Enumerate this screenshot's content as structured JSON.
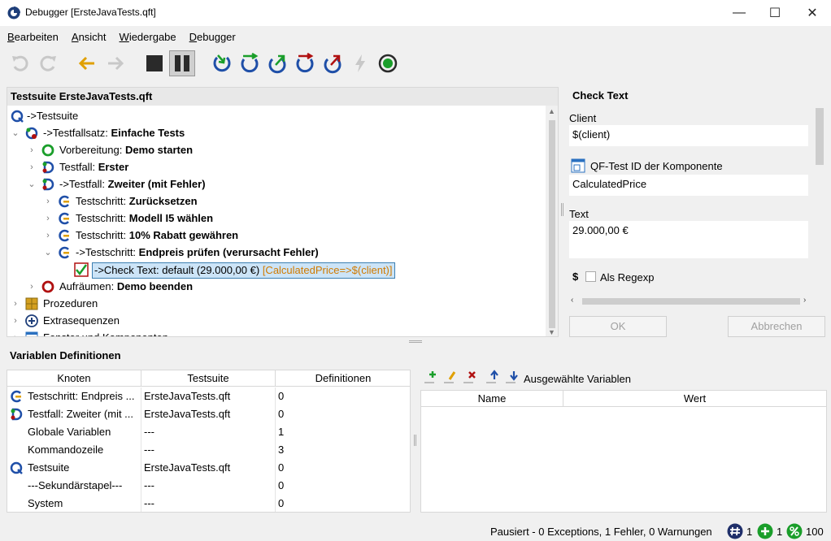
{
  "window": {
    "title": "Debugger [ErsteJavaTests.qft]",
    "minimize": "—",
    "maximize": "☐",
    "close": "✕"
  },
  "menu": [
    {
      "label": "Bearbeiten",
      "accel": "B",
      "rest": "earbeiten"
    },
    {
      "label": "Ansicht",
      "accel": "A",
      "rest": "nsicht"
    },
    {
      "label": "Wiedergabe",
      "accel": "W",
      "rest": "iedergabe"
    },
    {
      "label": "Debugger",
      "accel": "D",
      "rest": "ebugger"
    }
  ],
  "toolbar": {
    "icons": [
      "undo-icon",
      "redo-icon",
      "back-icon",
      "forward-icon",
      "stop-icon",
      "pause-icon",
      "step-in-icon",
      "step-over-icon",
      "step-out-icon",
      "skip-over-icon",
      "skip-out-icon",
      "continue-without-icon",
      "breakpoint-icon"
    ]
  },
  "tree": {
    "header": "Testsuite ErsteJavaTests.qft",
    "rows": [
      {
        "prefix": "->Testsuite",
        "bold": ""
      },
      {
        "prefix": "->Testfallsatz: ",
        "bold": "Einfache Tests"
      },
      {
        "prefix": "Vorbereitung: ",
        "bold": "Demo starten"
      },
      {
        "prefix": "Testfall: ",
        "bold": "Erster"
      },
      {
        "prefix": "->Testfall: ",
        "bold": "Zweiter (mit Fehler)"
      },
      {
        "prefix": "Testschritt: ",
        "bold": "Zurücksetzen"
      },
      {
        "prefix": "Testschritt: ",
        "bold": "Modell I5 wählen"
      },
      {
        "prefix": "Testschritt: ",
        "bold": "10% Rabatt gewähren"
      },
      {
        "prefix": "->Testschritt: ",
        "bold": "Endpreis prüfen (verursacht Fehler)"
      },
      {
        "prefix": "->Check Text: default (29.000,00 €) ",
        "extra": "[CalculatedPrice=>$(client)]"
      },
      {
        "prefix": "Aufräumen: ",
        "bold": "Demo beenden"
      },
      {
        "prefix": "Prozeduren",
        "bold": ""
      },
      {
        "prefix": "Extrasequenzen",
        "bold": ""
      },
      {
        "prefix": "Fenster und Komponenten",
        "bold": ""
      }
    ]
  },
  "check": {
    "title": "Check Text",
    "client_label": "Client",
    "client_value": "$(client)",
    "component_label": "QF-Test ID der Komponente",
    "component_value": "CalculatedPrice",
    "text_label": "Text",
    "text_value": "29.000,00 €",
    "regexp_label": "Als Regexp",
    "regexp_symbol": "$",
    "ok": "OK",
    "cancel": "Abbrechen"
  },
  "vars": {
    "title": "Variablen Definitionen",
    "columns": [
      "Knoten",
      "Testsuite",
      "Definitionen"
    ],
    "rows": [
      [
        "Testschritt: Endpreis ...",
        "ErsteJavaTests.qft",
        "0"
      ],
      [
        "Testfall: Zweiter (mit ...",
        "ErsteJavaTests.qft",
        "0"
      ],
      [
        "Globale Variablen",
        "---",
        "1"
      ],
      [
        "Kommandozeile",
        "---",
        "3"
      ],
      [
        "Testsuite",
        "ErsteJavaTests.qft",
        "0"
      ],
      [
        "---Sekundärstapel---",
        "---",
        "0"
      ],
      [
        "System",
        "---",
        "0"
      ]
    ]
  },
  "selected_vars": {
    "label": "Ausgewählte Variablen",
    "columns": [
      "Name",
      "Wert"
    ]
  },
  "status": {
    "text": "Pausiert - 0 Exceptions, 1 Fehler, 0 Warnungen",
    "count1": "1",
    "count2": "1",
    "count3": "100"
  },
  "colors": {
    "accent_blue": "#1f4fa8",
    "green": "#1a9e2a",
    "red": "#b01010",
    "orange": "#d07a00"
  }
}
